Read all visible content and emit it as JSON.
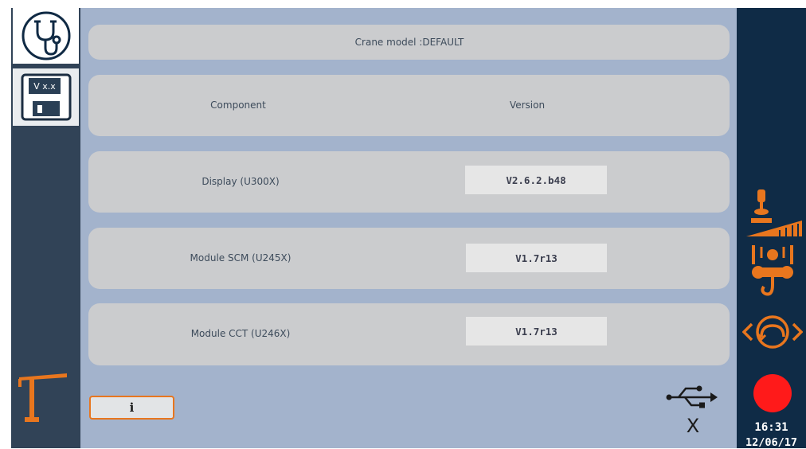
{
  "header": {
    "title": "Crane model :DEFAULT"
  },
  "table": {
    "columns": {
      "component": "Component",
      "version": "Version"
    },
    "rows": [
      {
        "component": "Display (U300X)",
        "version": "V2.6.2.b48"
      },
      {
        "component": "Module SCM (U245X)",
        "version": "V1.7r13"
      },
      {
        "component": "Module CCT (U246X)",
        "version": "V1.7r13"
      }
    ]
  },
  "left_nav": {
    "items": [
      {
        "name": "diagnostics",
        "icon": "stethoscope-icon",
        "active": true
      },
      {
        "name": "software-version",
        "icon": "floppy-disk-icon",
        "label": "V x.x",
        "active": false
      }
    ],
    "bottom_icon": "tower-crane-icon"
  },
  "footer": {
    "info_label": "i",
    "usb_icon": "usb-icon",
    "usb_status": "X"
  },
  "right_bar": {
    "icons": [
      "joystick-ramp-icon",
      "hook-pulley-icon",
      "slewing-icon"
    ],
    "record_icon": "record-dot",
    "time": "16:31",
    "date": "12/06/17"
  },
  "colors": {
    "accent": "#e8761e",
    "main_bg": "#a3b3cc",
    "left_bar": "#314357",
    "right_bar": "#0f2b46",
    "panel": "#cbccce",
    "record": "#ff1a1a"
  }
}
